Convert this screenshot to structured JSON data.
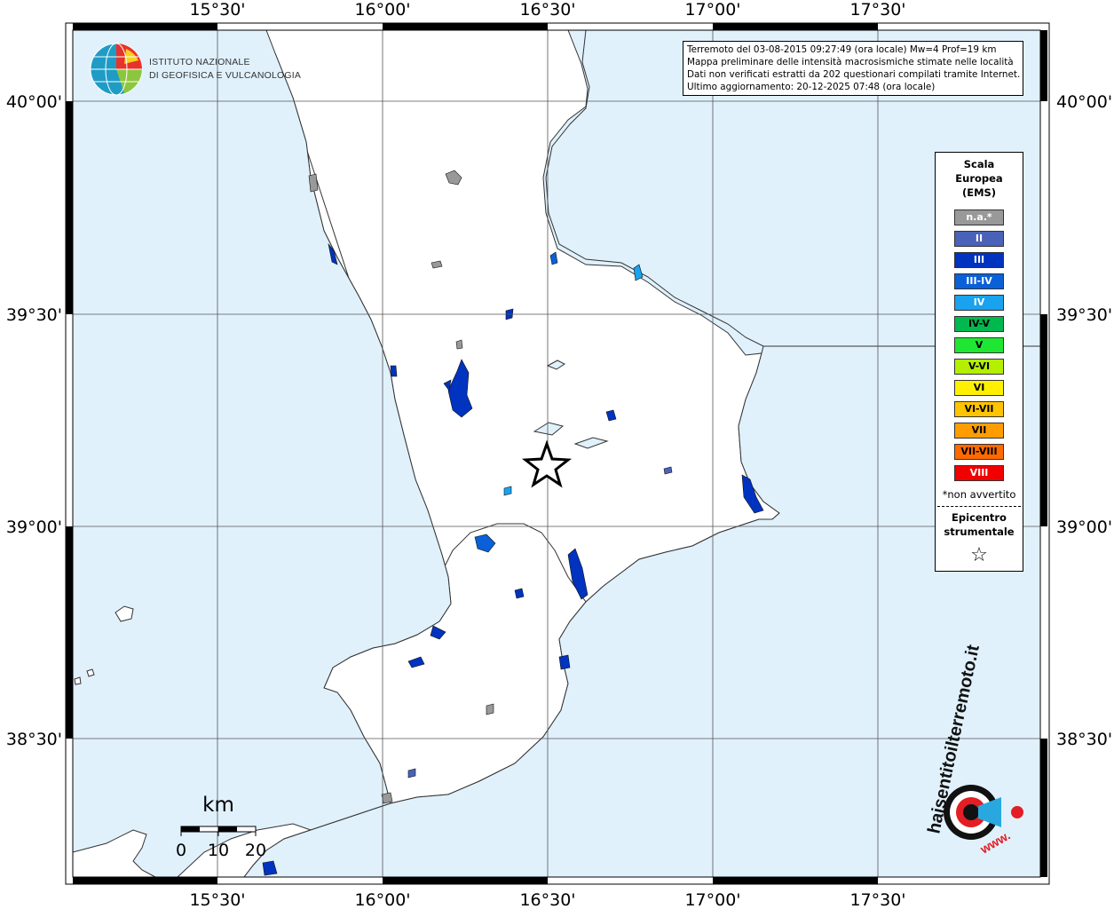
{
  "map": {
    "lon_labels": [
      "15°30'",
      "16°00'",
      "16°30'",
      "17°00'",
      "17°30'"
    ],
    "lat_labels": [
      "40°00'",
      "39°30'",
      "39°00'",
      "38°30'"
    ],
    "colors": {
      "sea": "#e0f1fc",
      "land": "#ffffff",
      "coast": "#333333"
    }
  },
  "info": {
    "line1": "Terremoto del 03-08-2015 09:27:49 (ora locale) Mw=4 Prof=19 km",
    "line2": "Mappa preliminare delle intensità macrosismiche stimate nelle località",
    "line3": "Dati non verificati estratti da 202 questionari compilati tramite Internet.",
    "line4": "Ultimo aggiornamento: 20-12-2025 07:48 (ora locale)"
  },
  "logo": {
    "ingv_line1": "ISTITUTO NAZIONALE",
    "ingv_line2": "DI GEOFISICA E VULCANOLOGIA",
    "hst_main": "haisentitoilterremoto.it",
    "hst_www": "www."
  },
  "scale_bar": {
    "unit": "km",
    "labels": [
      "0",
      "10",
      "20"
    ]
  },
  "legend": {
    "title1": "Scala",
    "title2": "Europea",
    "title3": "(EMS)",
    "items": [
      {
        "label": "n.a.*",
        "color": "#999999",
        "text": "#ffffff"
      },
      {
        "label": "II",
        "color": "#4a62b8",
        "text": "#ffffff"
      },
      {
        "label": "III",
        "color": "#0033c0",
        "text": "#ffffff"
      },
      {
        "label": "III-IV",
        "color": "#0a60d8",
        "text": "#ffffff"
      },
      {
        "label": "IV",
        "color": "#19a2ee",
        "text": "#ffffff"
      },
      {
        "label": "IV-V",
        "color": "#00b84e",
        "text": "#000000"
      },
      {
        "label": "V",
        "color": "#1ee632",
        "text": "#000000"
      },
      {
        "label": "V-VI",
        "color": "#b4ee00",
        "text": "#000000"
      },
      {
        "label": "VI",
        "color": "#fff000",
        "text": "#000000"
      },
      {
        "label": "VI-VII",
        "color": "#ffc400",
        "text": "#000000"
      },
      {
        "label": "VII",
        "color": "#ff9d00",
        "text": "#000000"
      },
      {
        "label": "VII-VIII",
        "color": "#ff6a00",
        "text": "#000000"
      },
      {
        "label": "VIII",
        "color": "#f20000",
        "text": "#ffffff"
      }
    ],
    "note": "*non avvertito",
    "epicenter_line1": "Epicentro",
    "epicenter_line2": "strumentale",
    "star_symbol": "☆"
  },
  "epicenter": {
    "symbol": "star-icon"
  }
}
